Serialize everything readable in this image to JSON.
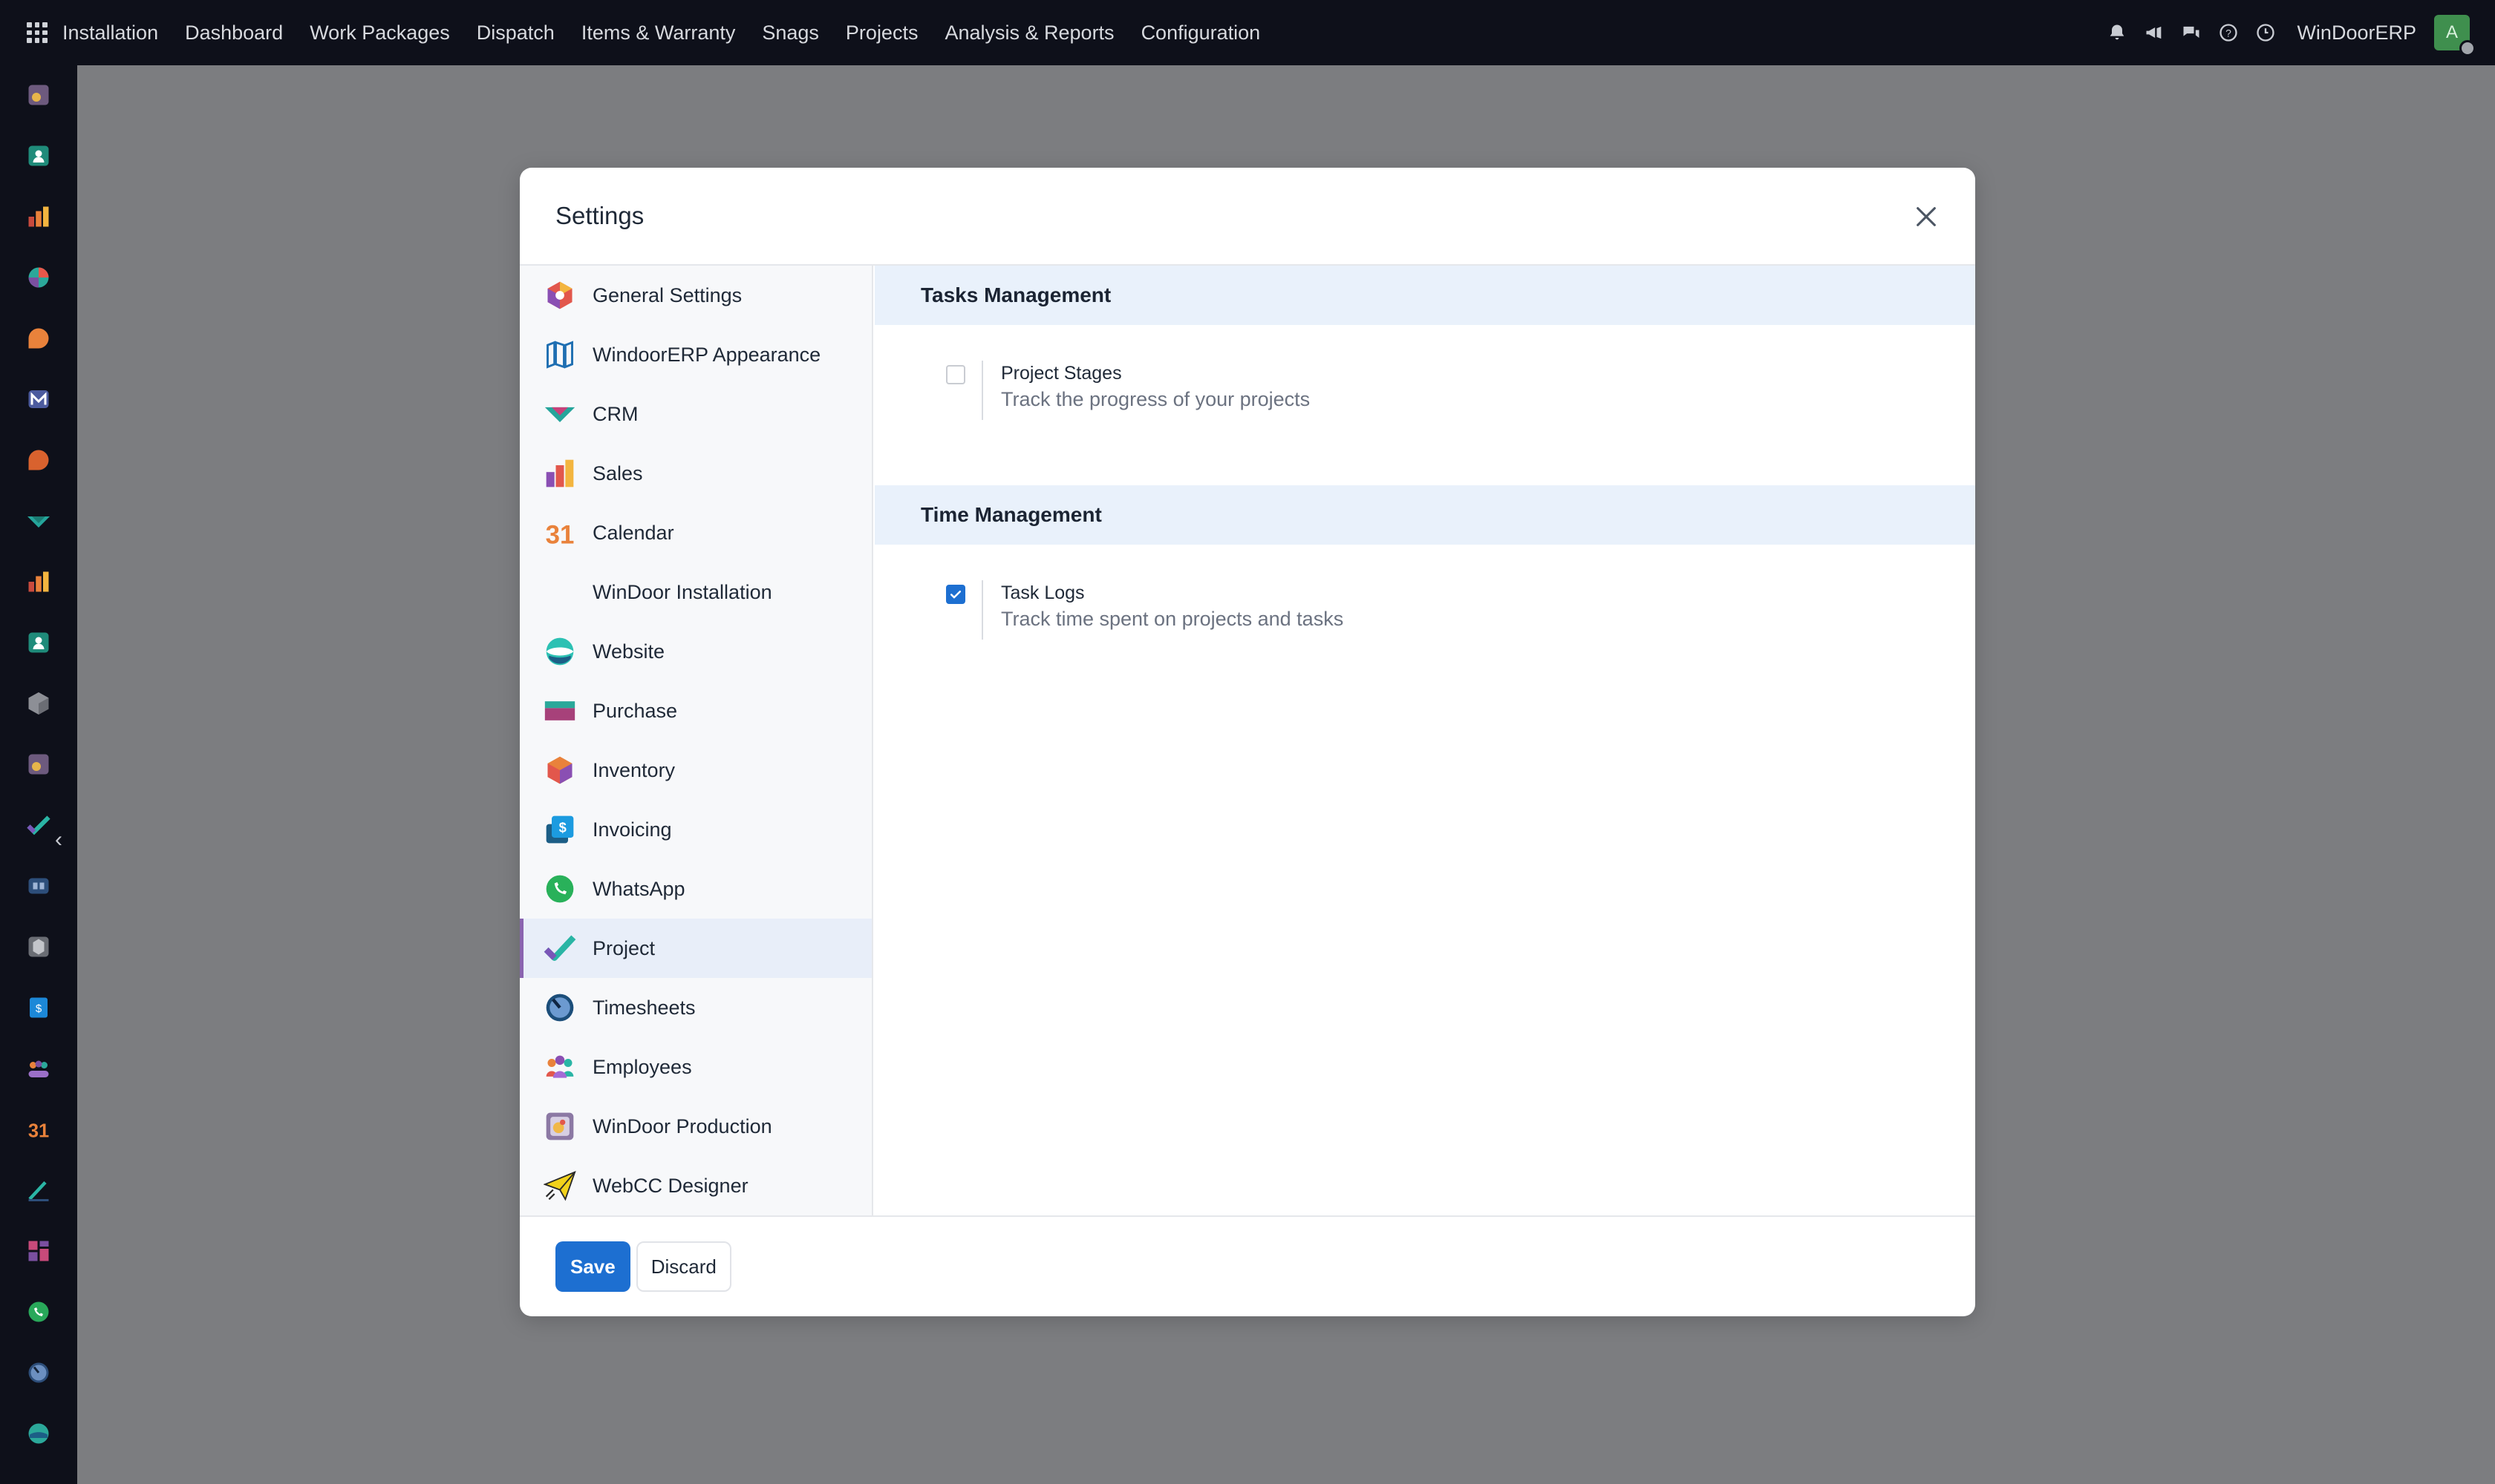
{
  "topbar": {
    "app_name": "Installation",
    "menu": [
      "Dashboard",
      "Work Packages",
      "Dispatch",
      "Items & Warranty",
      "Snags",
      "Projects",
      "Analysis & Reports",
      "Configuration"
    ],
    "company": "WinDoorERP",
    "avatar_initial": "A",
    "icons": [
      "bell-icon",
      "megaphone-icon",
      "chat-icon",
      "help-icon",
      "clock-icon"
    ]
  },
  "rail": {
    "icons": [
      "windoor-production-icon",
      "contacts-icon",
      "sales-icon",
      "website-icon",
      "discuss-icon",
      "email-icon",
      "discuss-icon",
      "crm-icon",
      "sales-icon",
      "contacts-icon",
      "inventory-icon",
      "windoor-production-icon",
      "project-icon",
      "knowledge-icon",
      "installation-icon",
      "invoicing-icon",
      "employees-icon",
      "calendar-icon",
      "sign-icon",
      "dashboards-icon",
      "whatsapp-icon",
      "timesheets-icon",
      "website-icon"
    ]
  },
  "modal": {
    "title": "Settings",
    "nav": [
      {
        "label": "General Settings",
        "icon": "general-settings-icon"
      },
      {
        "label": "WindoorERP Appearance",
        "icon": "appearance-icon"
      },
      {
        "label": "CRM",
        "icon": "crm-icon"
      },
      {
        "label": "Sales",
        "icon": "sales-icon"
      },
      {
        "label": "Calendar",
        "icon": "calendar-icon"
      },
      {
        "label": "WinDoor Installation",
        "icon": ""
      },
      {
        "label": "Website",
        "icon": "website-icon"
      },
      {
        "label": "Purchase",
        "icon": "purchase-icon"
      },
      {
        "label": "Inventory",
        "icon": "inventory-icon"
      },
      {
        "label": "Invoicing",
        "icon": "invoicing-icon"
      },
      {
        "label": "WhatsApp",
        "icon": "whatsapp-icon"
      },
      {
        "label": "Project",
        "icon": "project-icon",
        "active": true
      },
      {
        "label": "Timesheets",
        "icon": "timesheets-icon"
      },
      {
        "label": "Employees",
        "icon": "employees-icon"
      },
      {
        "label": "WinDoor Production",
        "icon": "windoor-production-icon"
      },
      {
        "label": "WebCC Designer",
        "icon": "webcc-designer-icon"
      }
    ],
    "sections": [
      {
        "title": "Tasks Management",
        "settings": [
          {
            "title": "Project Stages",
            "description": "Track the progress of your projects",
            "checked": false
          }
        ]
      },
      {
        "title": "Time Management",
        "settings": [
          {
            "title": "Task Logs",
            "description": "Track time spent on projects and tasks",
            "checked": true
          }
        ]
      }
    ],
    "buttons": {
      "save": "Save",
      "discard": "Discard"
    }
  },
  "colors": {
    "topbar_bg": "#0e101a",
    "backdrop": "#7c7d80",
    "primary": "#1d6fd1",
    "active_nav_bg": "#e8eef9",
    "active_nav_bar": "#8a64b0",
    "section_head_bg": "#e9f1fb"
  }
}
